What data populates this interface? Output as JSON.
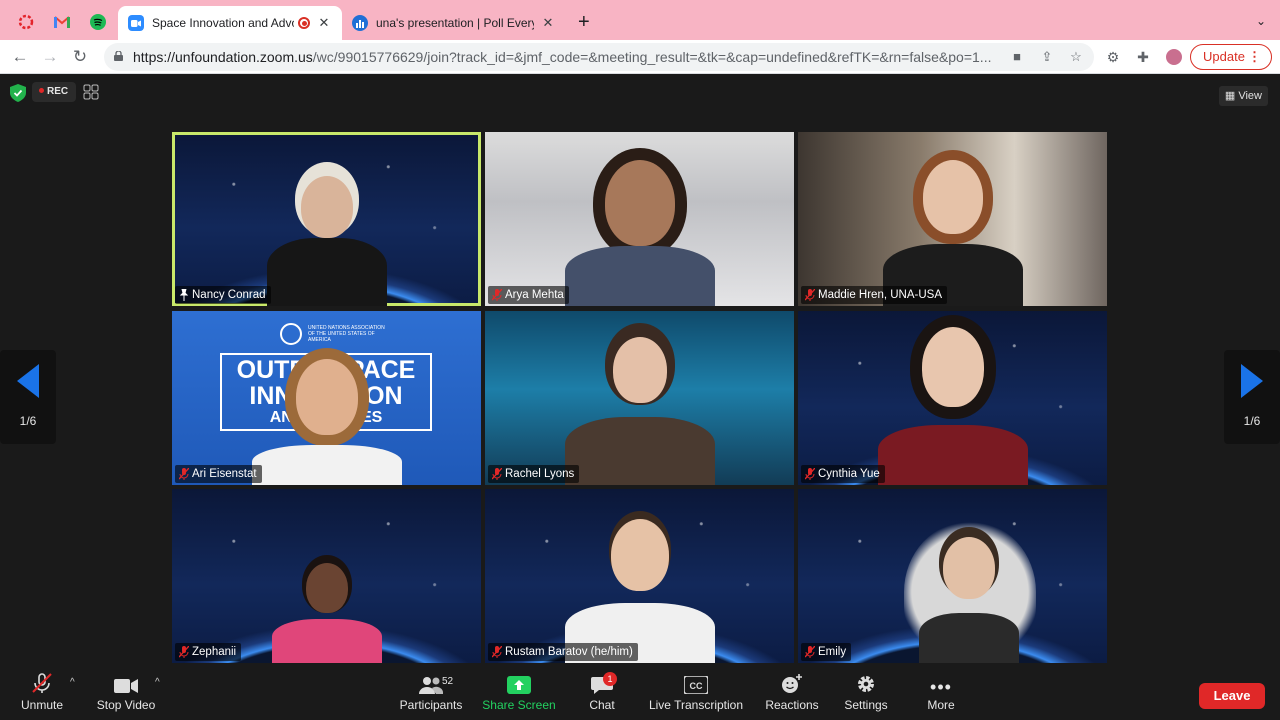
{
  "browser": {
    "tabs": [
      {
        "title": "Space Innovation and Advo",
        "active": true,
        "icon": "zoom-icon"
      },
      {
        "title": "una's presentation | Poll Everyw",
        "active": false,
        "icon": "poll-everywhere-icon"
      }
    ],
    "pinned": [
      "adobe-icon",
      "gmail-icon",
      "spotify-icon"
    ],
    "url_host": "https://unfoundation.zoom.us",
    "url_rest": "/wc/99015776629/join?track_id=&jmf_code=&meeting_result=&tk=&cap=undefined&refTK=&rn=false&po=1...",
    "update_label": "Update"
  },
  "meeting": {
    "rec_label": "REC",
    "view_label": "View",
    "page_indicator_left": "1/6",
    "page_indicator_right": "1/6",
    "participants": [
      {
        "name": "Nancy Conrad"
      },
      {
        "name": "Arya Mehta"
      },
      {
        "name": "Maddie Hren, UNA-USA"
      },
      {
        "name": "Ari Eisenstat"
      },
      {
        "name": "Rachel Lyons"
      },
      {
        "name": "Cynthia Yue"
      },
      {
        "name": "Zephanii"
      },
      {
        "name": "Rustam Baratov (he/him)"
      },
      {
        "name": "Emily"
      }
    ],
    "una_banner": {
      "org": "UNITED NATIONS ASSOCIATION OF THE UNITED STATES OF AMERICA",
      "line1": "OUTER SPACE",
      "line2": "INNOVATION",
      "line3": "AND A   SERIES"
    }
  },
  "footer": {
    "unmute": "Unmute",
    "stop_video": "Stop Video",
    "participants": "Participants",
    "participants_count": "52",
    "share_screen": "Share Screen",
    "chat": "Chat",
    "chat_badge": "1",
    "live_transcription": "Live Transcription",
    "reactions": "Reactions",
    "settings": "Settings",
    "more": "More",
    "leave": "Leave"
  },
  "colors": {
    "tab_strip": "#f8b4c4",
    "active_speaker": "#c8e86a",
    "zoom_blue": "#1a73e8",
    "leave_red": "#e02828",
    "share_green": "#23d160"
  }
}
